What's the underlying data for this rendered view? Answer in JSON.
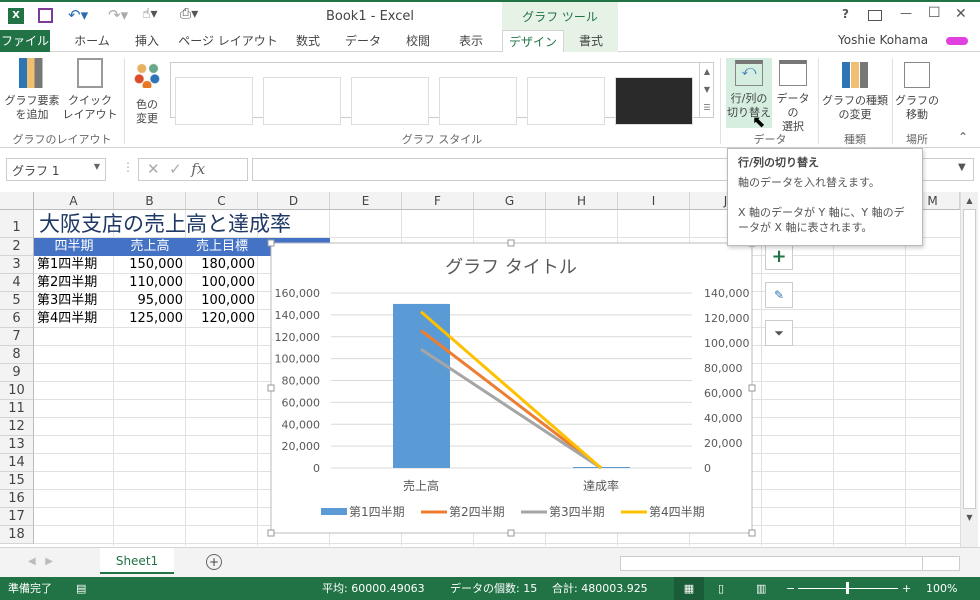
{
  "window": {
    "title": "Book1 - Excel",
    "context_tab": "グラフ ツール",
    "user": "Yoshie Kohama",
    "help": "?",
    "minimize": "—",
    "maximize": "☐",
    "close": "✕"
  },
  "tabs": [
    "ファイル",
    "ホーム",
    "挿入",
    "ページ レイアウト",
    "数式",
    "データ",
    "校閲",
    "表示",
    "デザイン",
    "書式"
  ],
  "ribbon": {
    "add_element": "グラフ要素\nを追加",
    "quick_layout": "クイック\nレイアウト",
    "layout_group": "グラフのレイアウト",
    "change_colors": "色の\n変更",
    "styles_group": "グラフ スタイル",
    "switch_row_col": "行/列の\n切り替え",
    "select_data": "データの\n選択",
    "data_group": "データ",
    "change_type": "グラフの種類\nの変更",
    "type_group": "種類",
    "move_chart": "グラフの\n移動",
    "location_group": "場所"
  },
  "tooltip": {
    "title": "行/列の切り替え",
    "line1": "軸のデータを入れ替えます。",
    "line2": "X 軸のデータが Y 軸に、Y 軸のデータが X 軸に表されます。"
  },
  "formula_bar": {
    "name_box": "グラフ 1",
    "fx": "fx",
    "value": ""
  },
  "columns": [
    "A",
    "B",
    "C",
    "D",
    "E",
    "F",
    "G",
    "H",
    "I",
    "J",
    "K",
    "L",
    "M"
  ],
  "rows": [
    "1",
    "2",
    "3",
    "4",
    "5",
    "6",
    "7",
    "8",
    "9",
    "10",
    "11",
    "12",
    "13",
    "14",
    "15",
    "16",
    "17",
    "18"
  ],
  "sheet": {
    "title": "大阪支店の売上高と達成率",
    "headers": [
      "四半期",
      "売上高",
      "売上目標"
    ],
    "data": [
      [
        "第1四半期",
        "150,000",
        "180,000"
      ],
      [
        "第2四半期",
        "110,000",
        "100,000"
      ],
      [
        "第3四半期",
        "95,000",
        "100,000"
      ],
      [
        "第4四半期",
        "125,000",
        "120,000"
      ]
    ],
    "header_color": "#4472c4"
  },
  "chart_data": {
    "type": "bar",
    "title": "グラフ タイトル",
    "categories": [
      "売上高",
      "達成率"
    ],
    "series": [
      {
        "name": "第1四半期",
        "kind": "bar",
        "axis": "primary",
        "values": [
          150000,
          0.833
        ],
        "color": "#5b9bd5"
      },
      {
        "name": "第2四半期",
        "kind": "line",
        "axis": "secondary",
        "values": [
          110000,
          1.1
        ],
        "color": "#ed7d31"
      },
      {
        "name": "第3四半期",
        "kind": "line",
        "axis": "secondary",
        "values": [
          95000,
          0.95
        ],
        "color": "#a5a5a5"
      },
      {
        "name": "第4四半期",
        "kind": "line",
        "axis": "secondary",
        "values": [
          125000,
          1.042
        ],
        "color": "#ffc000"
      }
    ],
    "y_ticks": [
      "0",
      "20,000",
      "40,000",
      "60,000",
      "80,000",
      "100,000",
      "120,000",
      "140,000",
      "160,000"
    ],
    "y2_ticks": [
      "0",
      "20,000",
      "40,000",
      "60,000",
      "80,000",
      "100,000",
      "120,000",
      "140,000"
    ],
    "ylim": [
      0,
      160000
    ],
    "y2lim": [
      0,
      140000
    ],
    "grid": true,
    "legend": "bottom"
  },
  "sheet_tabs": [
    "Sheet1"
  ],
  "status": {
    "ready": "準備完了",
    "average": "平均: 60000.49063",
    "count": "データの個数: 15",
    "sum": "合計: 480003.925",
    "zoom": "100%"
  }
}
